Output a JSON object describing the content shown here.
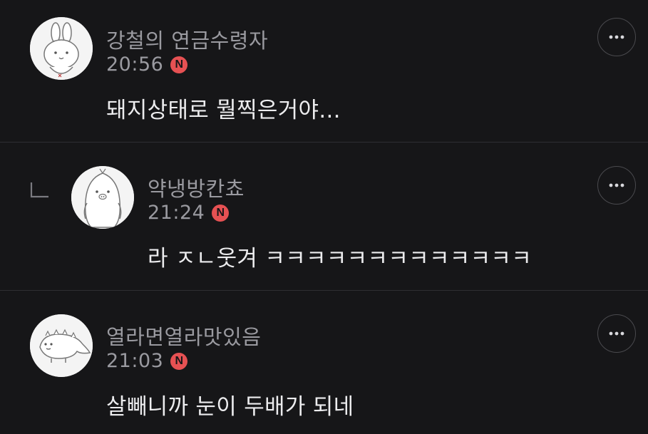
{
  "comments": [
    {
      "author": "강철의 연금수령자",
      "time": "20:56",
      "badge": "N",
      "text": "돼지상태로 뭘찍은거야...",
      "avatar_icon": "bunny-avatar-icon",
      "is_reply": false
    },
    {
      "author": "약냉방칸쵸",
      "time": "21:24",
      "badge": "N",
      "text": "라 ㅈㄴ웃겨 ㅋㅋㅋㅋㅋㅋㅋㅋㅋㅋㅋㅋㅋ",
      "avatar_icon": "penguin-avatar-icon",
      "is_reply": true
    },
    {
      "author": "열라면열라맛있음",
      "time": "21:03",
      "badge": "N",
      "text": "살빼니까 눈이 두배가 되네",
      "avatar_icon": "dinosaur-avatar-icon",
      "is_reply": false
    }
  ],
  "colors": {
    "background": "#161618",
    "divider": "#2e2e32",
    "meta_text": "#9a9aa0",
    "body_text": "#ececee",
    "new_badge": "#e65153"
  }
}
